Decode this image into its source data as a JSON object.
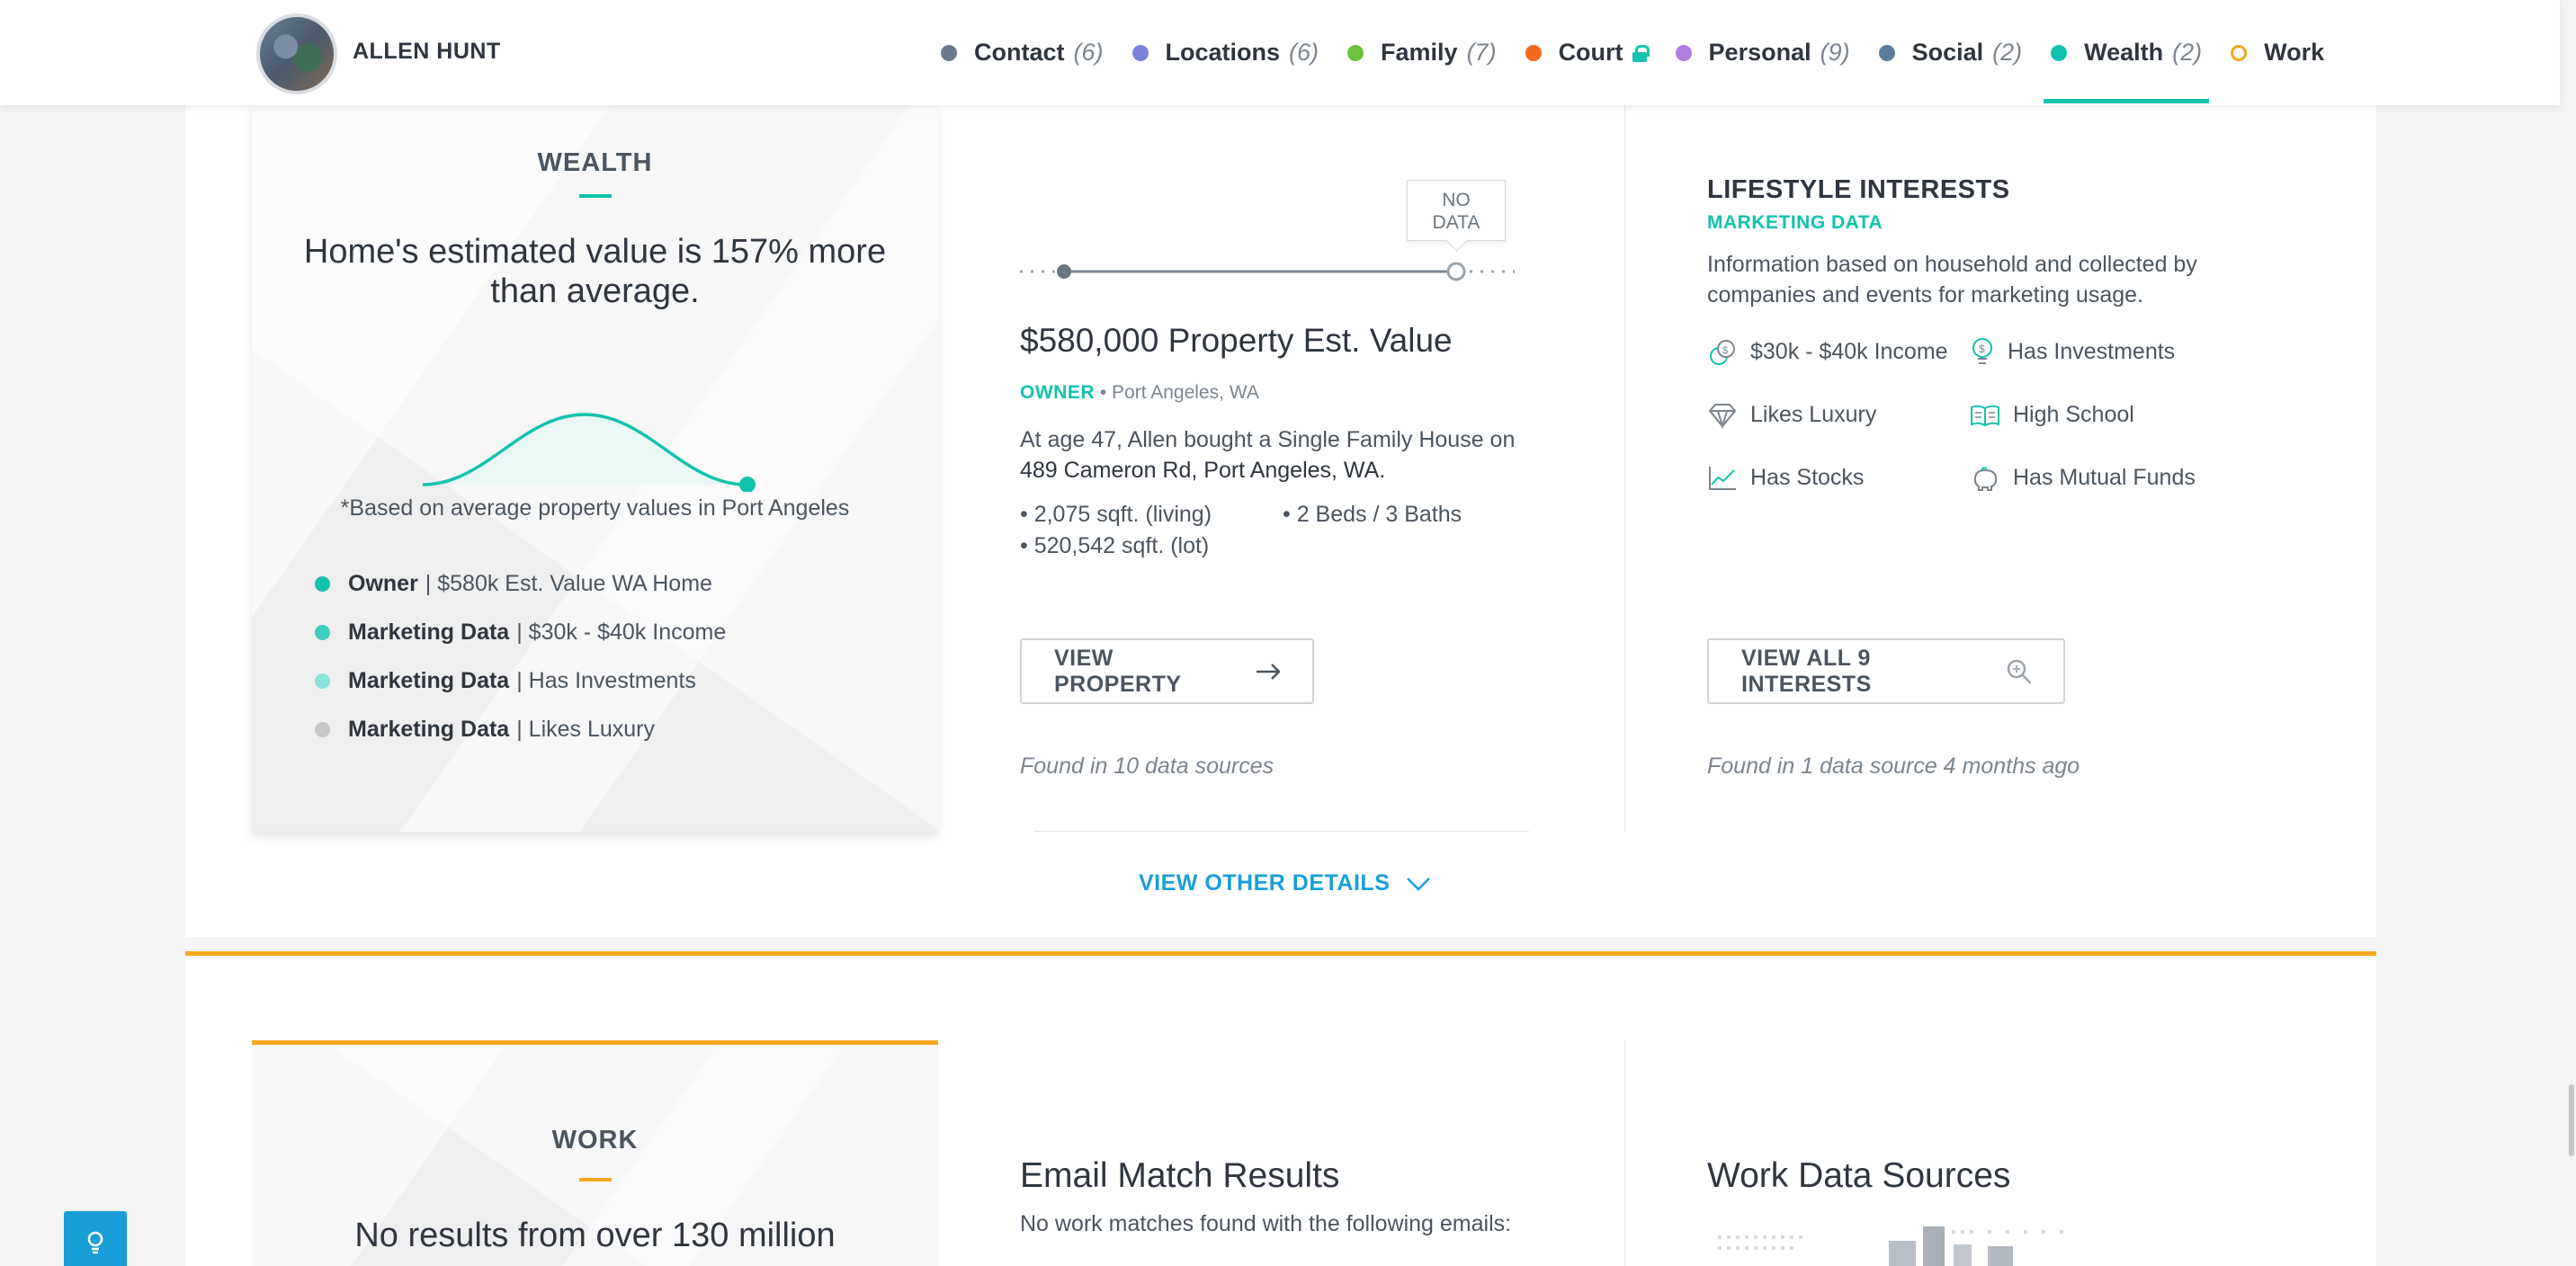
{
  "header": {
    "name": "ALLEN HUNT",
    "nav": [
      {
        "label": "Contact",
        "count": "(6)",
        "color": "#6b7a89"
      },
      {
        "label": "Locations",
        "count": "(6)",
        "color": "#7b82d9"
      },
      {
        "label": "Family",
        "count": "(7)",
        "color": "#6bc23b"
      },
      {
        "label": "Court",
        "count": "",
        "color": "#f26a1d"
      },
      {
        "label": "Personal",
        "count": "(9)",
        "color": "#b07de0"
      },
      {
        "label": "Social",
        "count": "(2)",
        "color": "#5a7d9c"
      },
      {
        "label": "Wealth",
        "count": "(2)",
        "color": "#12c2ad"
      },
      {
        "label": "Work",
        "count": "",
        "color": "#f5a81e"
      }
    ]
  },
  "wealth": {
    "title": "WEALTH",
    "headline": "Home's estimated value is 157% more than average.",
    "footnote": "*Based on average property values in Port Angeles",
    "legend": [
      {
        "bold": "Owner",
        "text": "| $580k Est. Value WA Home",
        "color": "#12c2ad"
      },
      {
        "bold": "Marketing Data",
        "text": "| $30k - $40k Income",
        "color": "#3ccfbd"
      },
      {
        "bold": "Marketing Data",
        "text": "| Has Investments",
        "color": "#8be3d8"
      },
      {
        "bold": "Marketing Data",
        "text": "| Likes Luxury",
        "color": "#c7c7c7"
      }
    ],
    "no_data": "NO DATA",
    "property_title": "$580,000 Property Est. Value",
    "owner_tag": "OWNER",
    "owner_location": "Port Angeles, WA",
    "desc_line1": "At age 47, Allen bought a Single Family House on",
    "desc_line2": "489 Cameron Rd, Port Angeles, WA.",
    "specs": [
      "2,075 sqft. (living)",
      "2 Beds / 3 Baths",
      "520,542 sqft. (lot)"
    ],
    "view_property": "VIEW PROPERTY",
    "property_sources": "Found in 10 data sources",
    "lifestyle_title": "LIFESTYLE INTERESTS",
    "lifestyle_sub": "MARKETING DATA",
    "lifestyle_desc1": "Information based on household and collected by",
    "lifestyle_desc2": "companies and events for marketing usage.",
    "interests": [
      {
        "label": "$30k - $40k Income",
        "icon": "coins-icon"
      },
      {
        "label": "Has Investments",
        "icon": "money-bulb-icon"
      },
      {
        "label": "Likes Luxury",
        "icon": "diamond-icon"
      },
      {
        "label": "High School",
        "icon": "open-book-icon"
      },
      {
        "label": "Has Stocks",
        "icon": "stock-chart-icon"
      },
      {
        "label": "Has Mutual Funds",
        "icon": "piggy-bank-icon"
      }
    ],
    "view_interests": "VIEW ALL 9 INTERESTS",
    "interest_sources": "Found in 1 data source 4 months ago",
    "view_other": "VIEW OTHER DETAILS"
  },
  "work": {
    "title": "WORK",
    "headline": "No results from over 130 million",
    "email_title": "Email Match Results",
    "email_desc": "No work matches found with the following emails:",
    "sources_title": "Work Data Sources"
  }
}
